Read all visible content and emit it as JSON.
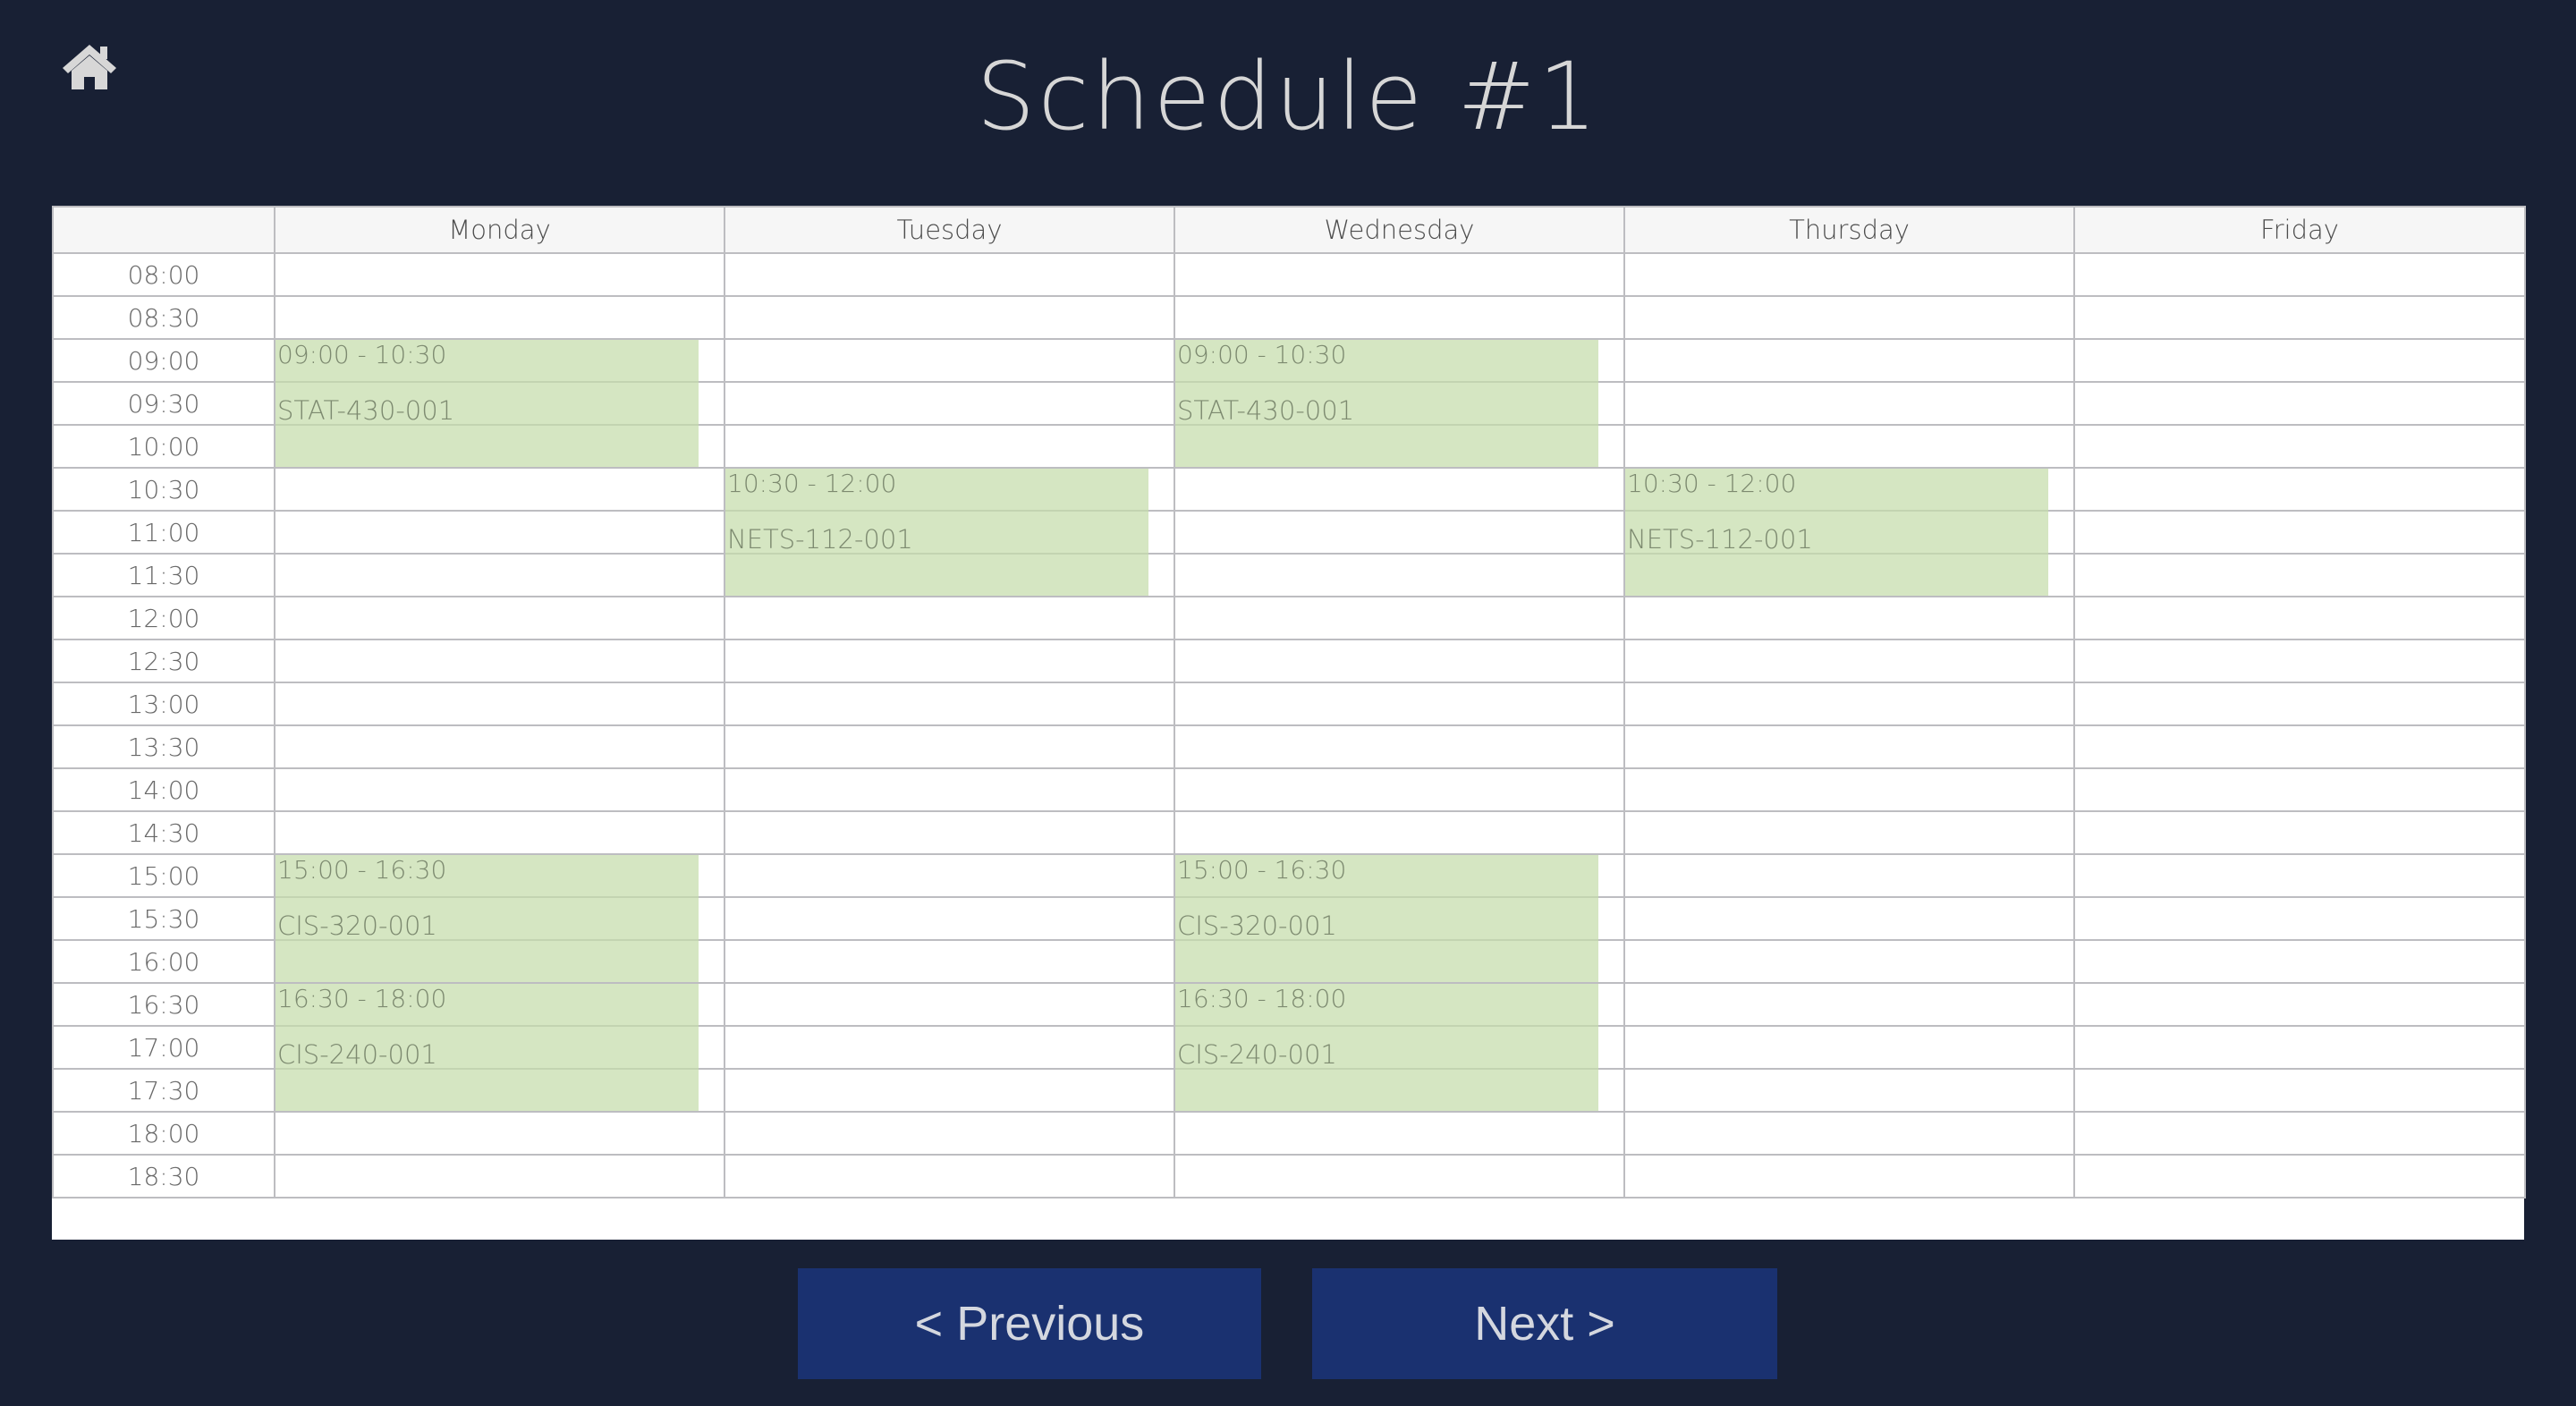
{
  "header": {
    "home_icon": "home-icon",
    "title": "Schedule #1"
  },
  "schedule": {
    "days": [
      "Monday",
      "Tuesday",
      "Wednesday",
      "Thursday",
      "Friday"
    ],
    "times": [
      "08:00",
      "08:30",
      "09:00",
      "09:30",
      "10:00",
      "10:30",
      "11:00",
      "11:30",
      "12:00",
      "12:30",
      "13:00",
      "13:30",
      "14:00",
      "14:30",
      "15:00",
      "15:30",
      "16:00",
      "16:30",
      "17:00",
      "17:30",
      "18:00",
      "18:30"
    ],
    "block_color": "#c5ddaa",
    "courses": [
      {
        "day": "Monday",
        "start": "09:00",
        "end": "10:30",
        "time_label": "09:00 - 10:30",
        "name": "STAT-430-001"
      },
      {
        "day": "Wednesday",
        "start": "09:00",
        "end": "10:30",
        "time_label": "09:00 - 10:30",
        "name": "STAT-430-001"
      },
      {
        "day": "Tuesday",
        "start": "10:30",
        "end": "12:00",
        "time_label": "10:30 - 12:00",
        "name": "NETS-112-001"
      },
      {
        "day": "Thursday",
        "start": "10:30",
        "end": "12:00",
        "time_label": "10:30 - 12:00",
        "name": "NETS-112-001"
      },
      {
        "day": "Monday",
        "start": "15:00",
        "end": "16:30",
        "time_label": "15:00 - 16:30",
        "name": "CIS-320-001"
      },
      {
        "day": "Wednesday",
        "start": "15:00",
        "end": "16:30",
        "time_label": "15:00 - 16:30",
        "name": "CIS-320-001"
      },
      {
        "day": "Monday",
        "start": "16:30",
        "end": "18:00",
        "time_label": "16:30 - 18:00",
        "name": "CIS-240-001"
      },
      {
        "day": "Wednesday",
        "start": "16:30",
        "end": "18:00",
        "time_label": "16:30 - 18:00",
        "name": "CIS-240-001"
      }
    ]
  },
  "navigation": {
    "previous_label": "< Previous",
    "next_label": "Next >",
    "button_color": "#1a3170"
  },
  "colors": {
    "background": "#182034",
    "title_text": "#d6d6d6"
  }
}
